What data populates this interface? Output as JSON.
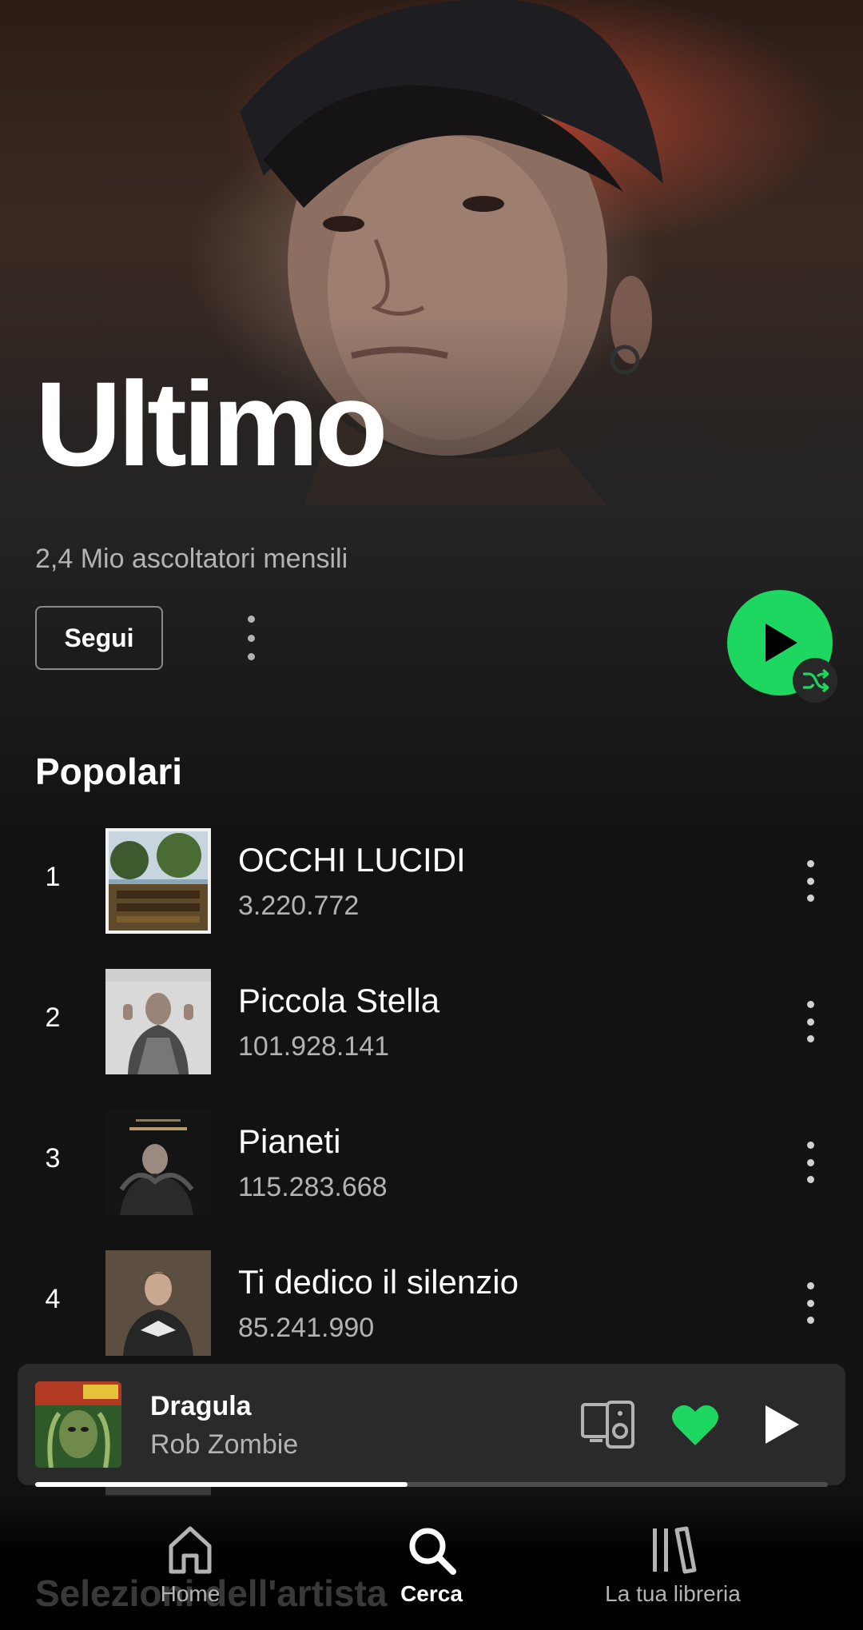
{
  "artist": {
    "name": "Ultimo",
    "monthly_listeners": "2,4 Mio ascoltatori mensili",
    "follow_label": "Segui"
  },
  "popular": {
    "title": "Popolari",
    "tracks": [
      {
        "rank": "1",
        "title": "OCCHI LUCIDI",
        "plays": "3.220.772"
      },
      {
        "rank": "2",
        "title": "Piccola Stella",
        "plays": "101.928.141"
      },
      {
        "rank": "3",
        "title": "Pianeti",
        "plays": "115.283.668"
      },
      {
        "rank": "4",
        "title": "Ti dedico il silenzio",
        "plays": "85.241.990"
      }
    ]
  },
  "player": {
    "title": "Dragula",
    "artist": "Rob Zombie",
    "progress": 0.47,
    "liked": true
  },
  "next_section": {
    "title": "Selezioni dell'artista"
  },
  "nav": [
    {
      "label": "Home",
      "icon": "home-icon",
      "active": false
    },
    {
      "label": "Cerca",
      "icon": "search-icon",
      "active": true
    },
    {
      "label": "La tua libreria",
      "icon": "library-icon",
      "active": false
    }
  ],
  "colors": {
    "accent": "#1ed760",
    "background": "#121212",
    "mini_player": "#2a2a2a"
  }
}
